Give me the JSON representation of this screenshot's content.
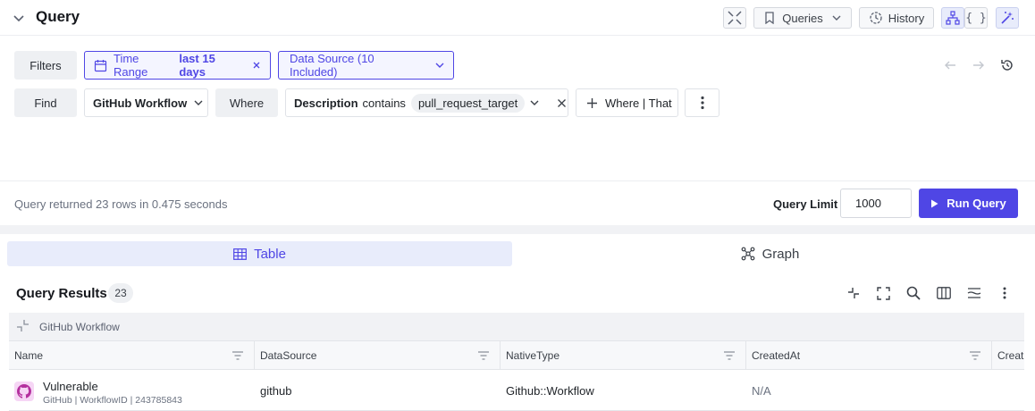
{
  "header": {
    "title": "Query",
    "queries_label": "Queries",
    "history_label": "History"
  },
  "filters": {
    "filters_label": "Filters",
    "time_range_label": "Time Range",
    "time_range_value": "last 15 days",
    "data_source_label": "Data Source (10 Included)"
  },
  "find": {
    "find_label": "Find",
    "entity_label": "GitHub Workflow",
    "where_label": "Where",
    "condition_field": "Description",
    "condition_operator": "contains",
    "condition_value": "pull_request_target",
    "add_condition_label": "Where | That"
  },
  "status": {
    "summary": "Query returned 23 rows in 0.475 seconds",
    "query_limit_label": "Query Limit",
    "query_limit_value": "1000",
    "run_label": "Run Query"
  },
  "tabs": [
    {
      "label": "Table",
      "active": true
    },
    {
      "label": "Graph",
      "active": false
    }
  ],
  "results": {
    "title": "Query Results",
    "count": "23",
    "group_label": "GitHub Workflow",
    "columns": [
      "Name",
      "DataSource",
      "NativeType",
      "CreatedAt",
      "Creat"
    ],
    "rows": [
      {
        "name": "Vulnerable",
        "sub": "GitHub | WorkflowID | 243785843",
        "datasource": "github",
        "nativetype": "Github::Workflow",
        "createdat": "N/A"
      }
    ]
  },
  "colors": {
    "accent": "#4f46e5",
    "accent_bg": "#e8ecfb",
    "github_avatar_bg": "#f6d6f5"
  }
}
